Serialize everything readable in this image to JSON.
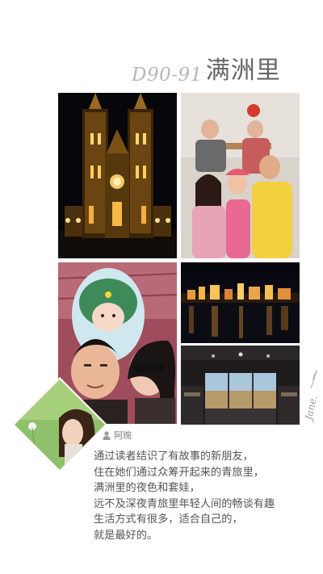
{
  "title": {
    "day": "D90-91",
    "place": "满洲里"
  },
  "author": {
    "icon": "person-icon",
    "name": "阿琬"
  },
  "body": {
    "lines": [
      "通过读者结识了有故事的新朋友，",
      "住在她们通过众筹开起来的青旅里，",
      "满洲里的夜色和套娃，",
      "远不及深夜青旅里年轻人间的畅谈有趣",
      "生活方式有很多，适合自己的，",
      "就是最好的。"
    ]
  },
  "signature": {
    "text": "Jane."
  },
  "photos": [
    {
      "name": "cathedral-night-photo"
    },
    {
      "name": "friends-group-photo"
    },
    {
      "name": "couple-selfie-matryoshka-photo"
    },
    {
      "name": "city-night-skyline-photo"
    },
    {
      "name": "hostel-window-room-photo"
    }
  ]
}
